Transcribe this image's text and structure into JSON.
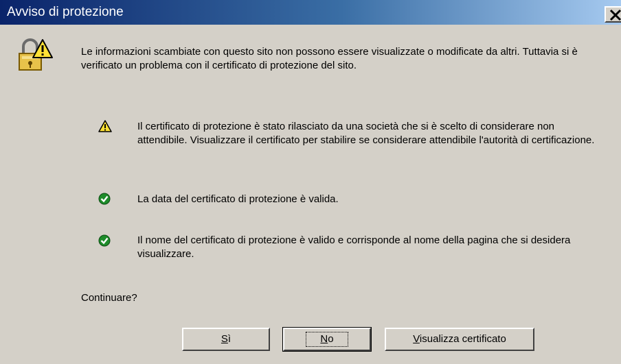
{
  "window": {
    "title": "Avviso di protezione"
  },
  "dialog": {
    "intro": "Le informazioni scambiate con questo sito non possono essere visualizzate o modificate da altri. Tuttavia si è verificato un problema con il certificato di protezione del sito.",
    "items": [
      {
        "icon": "warning-icon",
        "text": "Il certificato di protezione è stato rilasciato da una società che si è scelto di considerare non attendibile. Visualizzare il certificato per stabilire se considerare attendibile l'autorità di certificazione."
      },
      {
        "icon": "check-icon",
        "text": "La data del certificato di protezione è valida."
      },
      {
        "icon": "check-icon",
        "text": "Il nome del certificato di protezione è valido e corrisponde al nome della pagina che si desidera visualizzare."
      }
    ],
    "question": "Continuare?"
  },
  "buttons": {
    "yes_accel": "S",
    "yes_rest": "ì",
    "no_accel": "N",
    "no_rest": "o",
    "view_accel": "V",
    "view_rest": "isualizza certificato"
  },
  "colors": {
    "face": "#d4d0c8",
    "title_start": "#0a246a",
    "title_end": "#a6caf0",
    "warning": "#ffe135",
    "ok": "#1e8c2a"
  }
}
